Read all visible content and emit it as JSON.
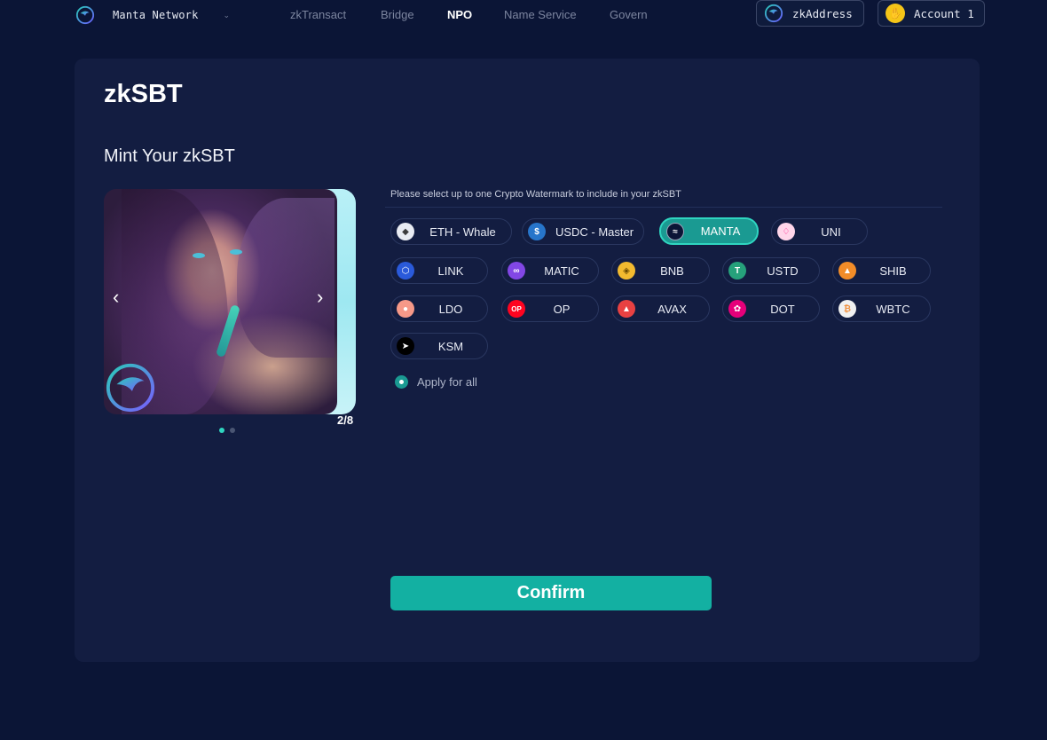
{
  "nav": {
    "brand_name": "Manta Network",
    "links": [
      "zkTransact",
      "Bridge",
      "NPO",
      "Name Service",
      "Govern"
    ],
    "active_link": "NPO",
    "zkaddress_label": "zkAddress",
    "account_label": "Account 1"
  },
  "page": {
    "title": "zkSBT",
    "section_title": "Mint Your zkSBT"
  },
  "carousel": {
    "counter": "2/8",
    "prev_arrow": "‹",
    "next_arrow": "›",
    "dots": 2,
    "active_dot": 0
  },
  "watermark": {
    "caption": "Please select up to one Crypto Watermark to include in your zkSBT",
    "selected": "MANTA",
    "options": [
      {
        "label": "ETH - Whale",
        "icon": "eth-icon",
        "color": "#e9ecf3"
      },
      {
        "label": "USDC - Master",
        "icon": "usdc-icon",
        "color": "#2775ca"
      },
      {
        "label": "MANTA",
        "icon": "manta-icon",
        "color": "#0b1536"
      },
      {
        "label": "UNI",
        "icon": "uni-icon",
        "color": "#ffd6ea"
      },
      {
        "label": "LINK",
        "icon": "link-icon",
        "color": "#2a5ada"
      },
      {
        "label": "MATIC",
        "icon": "matic-icon",
        "color": "#8247e5"
      },
      {
        "label": "BNB",
        "icon": "bnb-icon",
        "color": "#f3ba2f"
      },
      {
        "label": "USTD",
        "icon": "usdt-icon",
        "color": "#26a17b"
      },
      {
        "label": "SHIB",
        "icon": "shib-icon",
        "color": "#f28c28"
      },
      {
        "label": "LDO",
        "icon": "ldo-icon",
        "color": "#f69988"
      },
      {
        "label": "OP",
        "icon": "op-icon",
        "color": "#ff0420"
      },
      {
        "label": "AVAX",
        "icon": "avax-icon",
        "color": "#e84142"
      },
      {
        "label": "DOT",
        "icon": "dot-icon",
        "color": "#e6007a"
      },
      {
        "label": "WBTC",
        "icon": "wbtc-icon",
        "color": "#f0f0f0"
      },
      {
        "label": "KSM",
        "icon": "ksm-icon",
        "color": "#000000"
      }
    ],
    "apply_all_label": "Apply for all"
  },
  "actions": {
    "confirm_label": "Confirm"
  },
  "colors": {
    "background": "#0b1536",
    "card": "#131d41",
    "accent": "#13b0a2",
    "accent_light": "#2fd5c0"
  }
}
